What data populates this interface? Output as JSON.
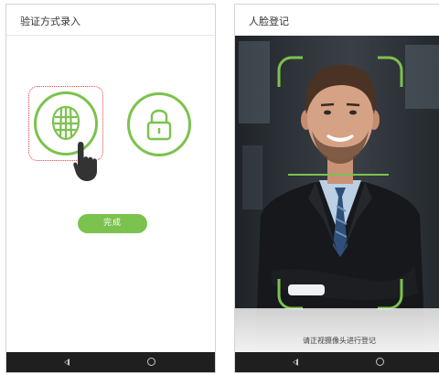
{
  "left_screen": {
    "header": {
      "title": "验证方式录入"
    },
    "options": [
      {
        "name": "face",
        "icon": "face-grid-icon",
        "selected": true
      },
      {
        "name": "password",
        "icon": "lock-icon",
        "selected": false
      }
    ],
    "done_button": {
      "label": "完成"
    }
  },
  "right_screen": {
    "header": {
      "title": "人脸登记"
    },
    "prompt": "请正视摄像头进行登记"
  },
  "nav": {
    "back_icon": "triangle-back-icon",
    "home_icon": "circle-home-icon"
  },
  "colors": {
    "accent": "#7cc24e",
    "selection": "#e0403a",
    "navbar": "#1f1f1f"
  }
}
